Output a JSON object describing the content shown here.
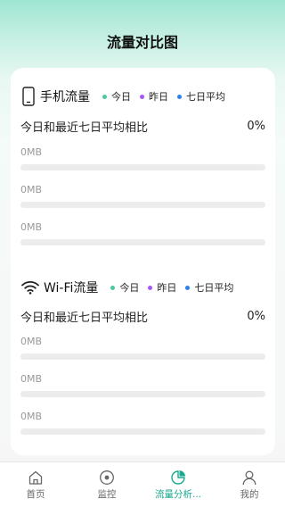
{
  "header": {
    "title": "流量对比图"
  },
  "legend": [
    {
      "label": "今日",
      "color": "#4cc6a3"
    },
    {
      "label": "昨日",
      "color": "#a855f7"
    },
    {
      "label": "七日平均",
      "color": "#2f80ed"
    }
  ],
  "mobile": {
    "title": "手机流量",
    "icon": "phone-icon",
    "compare_label": "今日和最近七日平均相比",
    "compare_value": "0%",
    "bars": [
      {
        "label": "0MB",
        "fraction": 0
      },
      {
        "label": "0MB",
        "fraction": 0
      },
      {
        "label": "0MB",
        "fraction": 0
      }
    ]
  },
  "wifi": {
    "title": "Wi-Fi流量",
    "icon": "wifi-icon",
    "compare_label": "今日和最近七日平均相比",
    "compare_value": "0%",
    "bars": [
      {
        "label": "0MB",
        "fraction": 0
      },
      {
        "label": "0MB",
        "fraction": 0
      },
      {
        "label": "0MB",
        "fraction": 0
      }
    ]
  },
  "tabs": [
    {
      "label": "首页",
      "icon": "home-icon",
      "active": false
    },
    {
      "label": "监控",
      "icon": "monitor-icon",
      "active": false
    },
    {
      "label": "流量分析...",
      "icon": "pie-chart-icon",
      "active": true
    },
    {
      "label": "我的",
      "icon": "user-icon",
      "active": false
    }
  ],
  "colors": {
    "accent": "#1aa88f",
    "track": "#ececec"
  }
}
